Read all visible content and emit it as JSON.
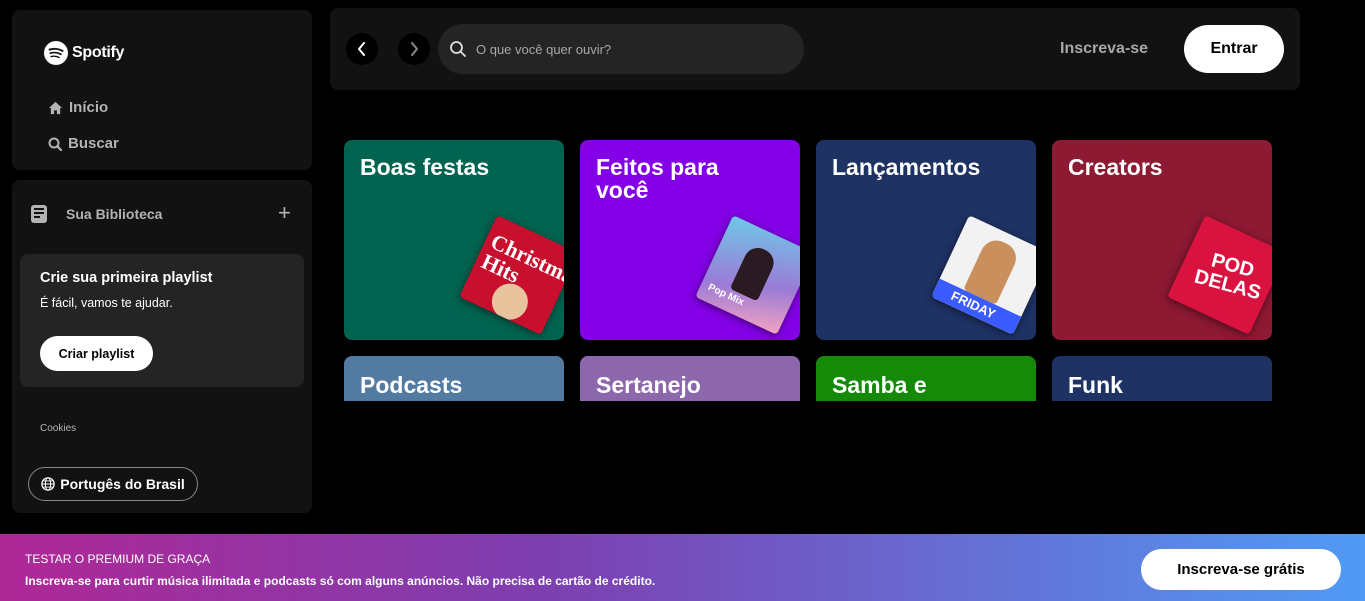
{
  "sidebar": {
    "logo_text": "Spotify",
    "nav": [
      {
        "label": "Início",
        "icon": "home-icon"
      },
      {
        "label": "Buscar",
        "icon": "search-icon"
      }
    ],
    "library": {
      "title": "Sua Biblioteca",
      "add_icon": "plus-icon",
      "card_title": "Crie sua primeira playlist",
      "card_subtitle": "É fácil, vamos te ajudar.",
      "card_button": "Criar playlist"
    },
    "cookies": "Cookies",
    "language": "Portugês do Brasil"
  },
  "topbar": {
    "search_placeholder": "O que você quer ouvir?",
    "signup_label": "Inscreva-se",
    "login_label": "Entrar"
  },
  "categories": [
    {
      "label": "Boas festas",
      "color": "#006450",
      "art": "Christmas Hits"
    },
    {
      "label": "Feitos para você",
      "color": "#8400e7",
      "art": "Pop Mix"
    },
    {
      "label": "Lançamentos",
      "color": "#1e3264",
      "art": "FRIDAY"
    },
    {
      "label": "Creators",
      "color": "#8d1932",
      "art": "POD DELAS"
    },
    {
      "label": "Podcasts",
      "color": "#537aa1"
    },
    {
      "label": "Sertanejo",
      "color": "#8d67ab"
    },
    {
      "label": "Samba e",
      "color": "#148a08"
    },
    {
      "label": "Funk",
      "color": "#1e3264"
    }
  ],
  "banner": {
    "title": "TESTAR O PREMIUM DE GRAÇA",
    "subtitle": "Inscreva-se para curtir música ilimitada e podcasts só com alguns anúncios. Não precisa de cartão de crédito.",
    "button": "Inscreva-se grátis"
  }
}
